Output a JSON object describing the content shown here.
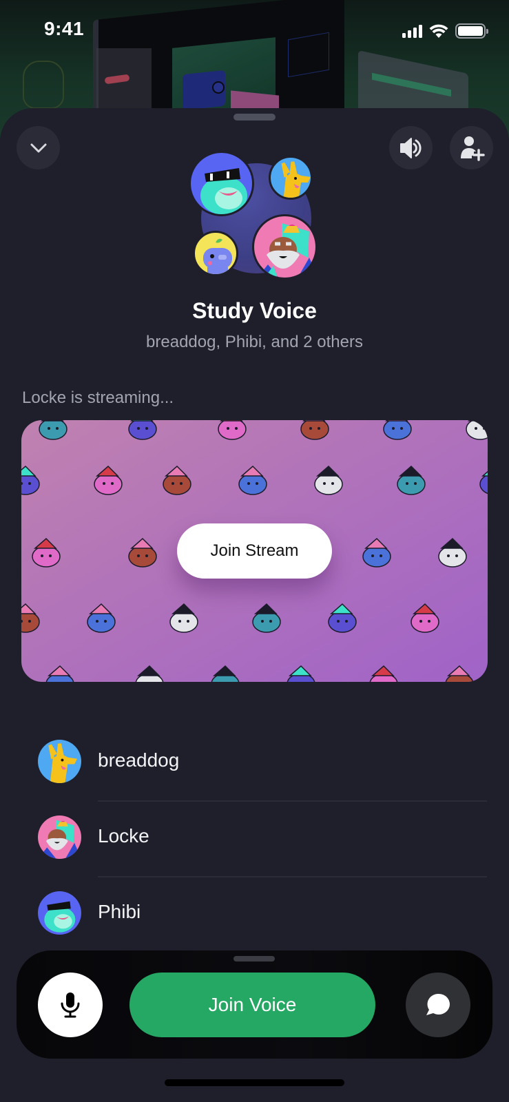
{
  "status_bar": {
    "time": "9:41",
    "icons": [
      "cellular-signal-icon",
      "wifi-icon",
      "battery-icon"
    ]
  },
  "header": {
    "collapse_icon": "chevron-down-icon",
    "speaker_icon": "speaker-icon",
    "invite_icon": "add-user-icon"
  },
  "channel": {
    "title": "Study Voice",
    "subtitle": "breaddog, Phibi, and 2 others",
    "participant_avatars": [
      "Phibi",
      "breaddog",
      "Clyde-bot",
      "Locke"
    ]
  },
  "stream": {
    "label": "Locke is streaming...",
    "join_label": "Join Stream"
  },
  "members": [
    {
      "name": "breaddog",
      "avatar_color": "#4ea8f2"
    },
    {
      "name": "Locke",
      "avatar_color": "#ef7ab4"
    },
    {
      "name": "Phibi",
      "avatar_color": "#5865f2"
    }
  ],
  "controls": {
    "mic_icon": "microphone-icon",
    "join_voice_label": "Join Voice",
    "chat_icon": "chat-bubble-icon"
  },
  "colors": {
    "background": "#1e1f2a",
    "join_voice_green": "#24a863",
    "button_dark": "#2a2b36",
    "text_muted": "#a2a5b0"
  }
}
